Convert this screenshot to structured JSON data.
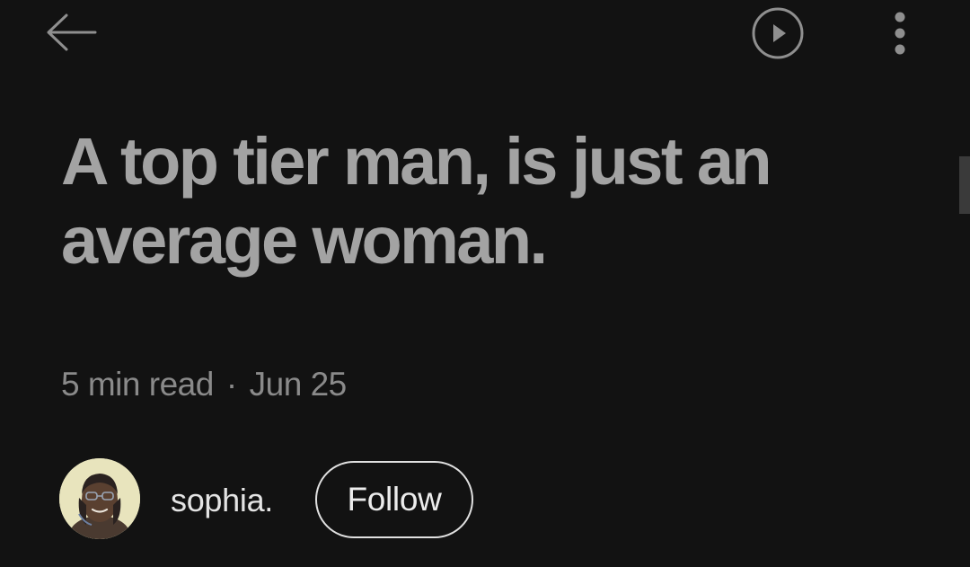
{
  "toolbar": {
    "back_icon": "arrow-left-icon",
    "play_icon": "play-circle-icon",
    "more_icon": "more-vertical-icon"
  },
  "article": {
    "title": "A top tier man, is just an average woman.",
    "read_time": "5 min read",
    "separator": "·",
    "date": "Jun 25"
  },
  "author": {
    "name": "sophia.",
    "follow_label": "Follow"
  },
  "colors": {
    "background": "#121212",
    "title": "#a3a3a3",
    "meta": "#8a8a8a",
    "author_name": "#e4e4e4",
    "follow_border": "#e0e0e0"
  }
}
